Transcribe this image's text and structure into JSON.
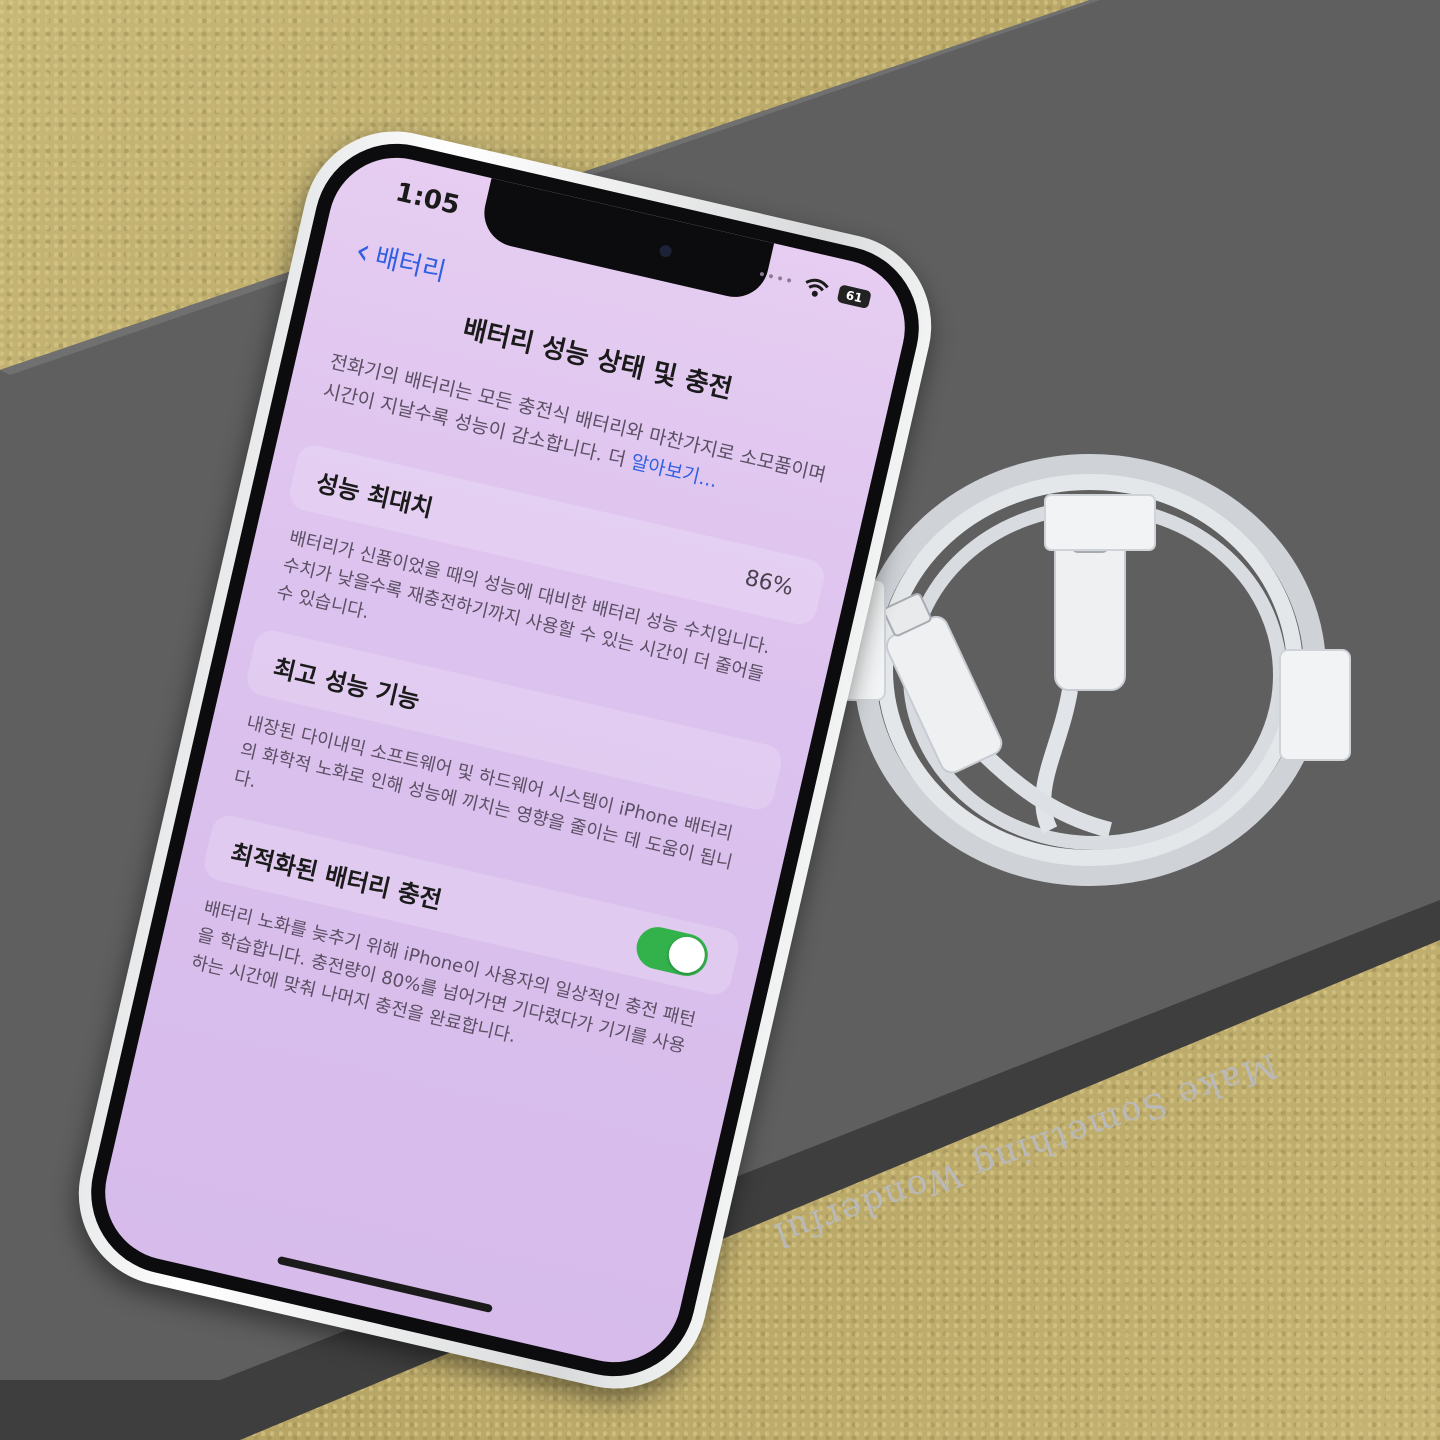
{
  "status": {
    "time": "1:05",
    "battery": "61"
  },
  "nav": {
    "back_label": "배터리",
    "title": "배터리 성능 상태 및 충전"
  },
  "intro": {
    "text": "전화기의 배터리는 모든 충전식 배터리와 마찬가지로 소모품이며 시간이 지날수록 성능이 감소합니다. 더 ",
    "link": "알아보기..."
  },
  "sections": [
    {
      "title": "성능 최대치",
      "value": "86%",
      "description": "배터리가 신품이었을 때의 성능에 대비한 배터리 성능 수치입니다. 수치가 낮을수록 재충전하기까지 사용할 수 있는 시간이 더 줄어들 수 있습니다."
    },
    {
      "title": "최고 성능 기능",
      "description": "내장된 다이내믹 소프트웨어 및 하드웨어 시스템이 iPhone 배터리의 화학적 노화로 인해 성능에 끼치는 영향을 줄이는 데 도움이 됩니다."
    },
    {
      "title": "최적화된 배터리 충전",
      "toggle_on": true,
      "description": "배터리 노화를 늦추기 위해 iPhone이 사용자의 일상적인 충전 패턴을 학습합니다. 충전량이 80%를 넘어가면 기다렸다가 기기를 사용하는 시간에 맞춰 나머지 충전을 완료합니다."
    }
  ],
  "book_text": "Make Something Wonderful",
  "colors": {
    "accent": "#2f5fe4",
    "toggle": "#33b24c",
    "screen": "#dcc2ee",
    "book": "#505050"
  }
}
